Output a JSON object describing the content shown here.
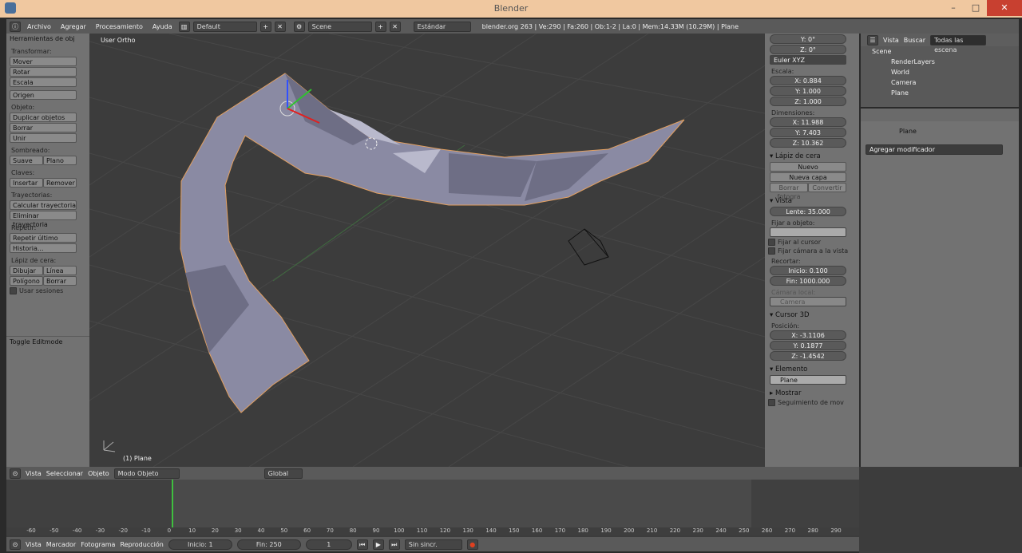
{
  "window": {
    "title": "Blender"
  },
  "topbar": {
    "menus": [
      "Archivo",
      "Agregar",
      "Procesamiento",
      "Ayuda"
    ],
    "layout": "Default",
    "scene": "Scene",
    "engine": "Estándar",
    "info": "blender.org 263 | Ve:290 | Fa:260 | Ob:1-2 | La:0 | Mem:14.33M (10.29M) | Plane"
  },
  "tools": {
    "header": "Herramientas de obj",
    "transform_label": "Transformar:",
    "move": "Mover",
    "rotate": "Rotar",
    "scale": "Escala",
    "origin": "Origen",
    "object_label": "Objeto:",
    "duplicate": "Duplicar objetos",
    "delete": "Borrar",
    "join": "Unir",
    "shading_label": "Sombreado:",
    "smooth": "Suave",
    "flat": "Plano",
    "keys_label": "Claves:",
    "insert": "Insertar",
    "remove": "Remover",
    "paths_label": "Trayectorias:",
    "calc_path": "Calcular trayectoria",
    "clear_path": "Eliminar trayectoria",
    "repeat_label": "Repetir:",
    "repeat_last": "Repetir último",
    "history": "Historia...",
    "gp_label": "Lápiz de cera:",
    "draw": "Dibujar",
    "line": "Línea",
    "poly": "Polígono",
    "erase": "Borrar",
    "sessions": "Usar sesiones",
    "toggle_edit": "Toggle Editmode"
  },
  "viewport": {
    "title": "User Ortho",
    "object": "(1) Plane"
  },
  "props": {
    "rot_y": "Y: 0°",
    "rot_z": "Z: 0°",
    "rot_mode": "Euler XYZ",
    "scale_label": "Escala:",
    "sx": "X: 0.884",
    "sy": "Y: 1.000",
    "sz": "Z: 1.000",
    "dim_label": "Dimensiones:",
    "dx": "X: 11.988",
    "dy": "Y: 7.403",
    "dz": "Z: 10.362",
    "gp_head": "Lápiz de cera",
    "new": "Nuevo",
    "new_layer": "Nueva capa",
    "del_frame": "Borrar fotogra",
    "convert": "Convertir",
    "view_head": "Vista",
    "lens": "Lente: 35.000",
    "lock_label": "Fijar a objeto:",
    "lock_cursor": "Fijar al cursor",
    "lock_cam": "Fijar cámara a la vista",
    "clip_label": "Recortar:",
    "clip_start": "Inicio: 0.100",
    "clip_end": "Fin: 1000.000",
    "local_cam": "Cámara local:",
    "camera": "Camera",
    "cursor_head": "Cursor 3D",
    "pos_label": "Posición:",
    "cx": "X: -3.1106",
    "cy": "Y: 0.1877",
    "cz": "Z: -1.4542",
    "item_head": "Elemento",
    "item_name": "Plane",
    "show_head": "Mostrar",
    "motion": "Seguimiento de mov"
  },
  "outliner": {
    "view": "Vista",
    "search": "Buscar",
    "filter": "Todas las escena",
    "items": [
      "Scene",
      "RenderLayers",
      "World",
      "Camera",
      "Plane"
    ]
  },
  "modifiers": {
    "object": "Plane",
    "add": "Agregar modificador"
  },
  "timeline": {
    "view": "Vista",
    "select": "Seleccionar",
    "object": "Objeto",
    "mode": "Modo Objeto",
    "orientation": "Global",
    "ticks": [
      "-60",
      "-50",
      "-40",
      "-30",
      "-20",
      "-10",
      "0",
      "10",
      "20",
      "30",
      "40",
      "50",
      "60",
      "70",
      "80",
      "90",
      "100",
      "110",
      "120",
      "130",
      "140",
      "150",
      "160",
      "170",
      "180",
      "190",
      "200",
      "210",
      "220",
      "230",
      "240",
      "250",
      "260",
      "270",
      "280",
      "290"
    ]
  },
  "bottom": {
    "view": "Vista",
    "marker": "Marcador",
    "frame": "Fotograma",
    "playback": "Reproducción",
    "start": "Inicio: 1",
    "end": "Fin: 250",
    "current": "1",
    "sync": "Sin sincr."
  }
}
